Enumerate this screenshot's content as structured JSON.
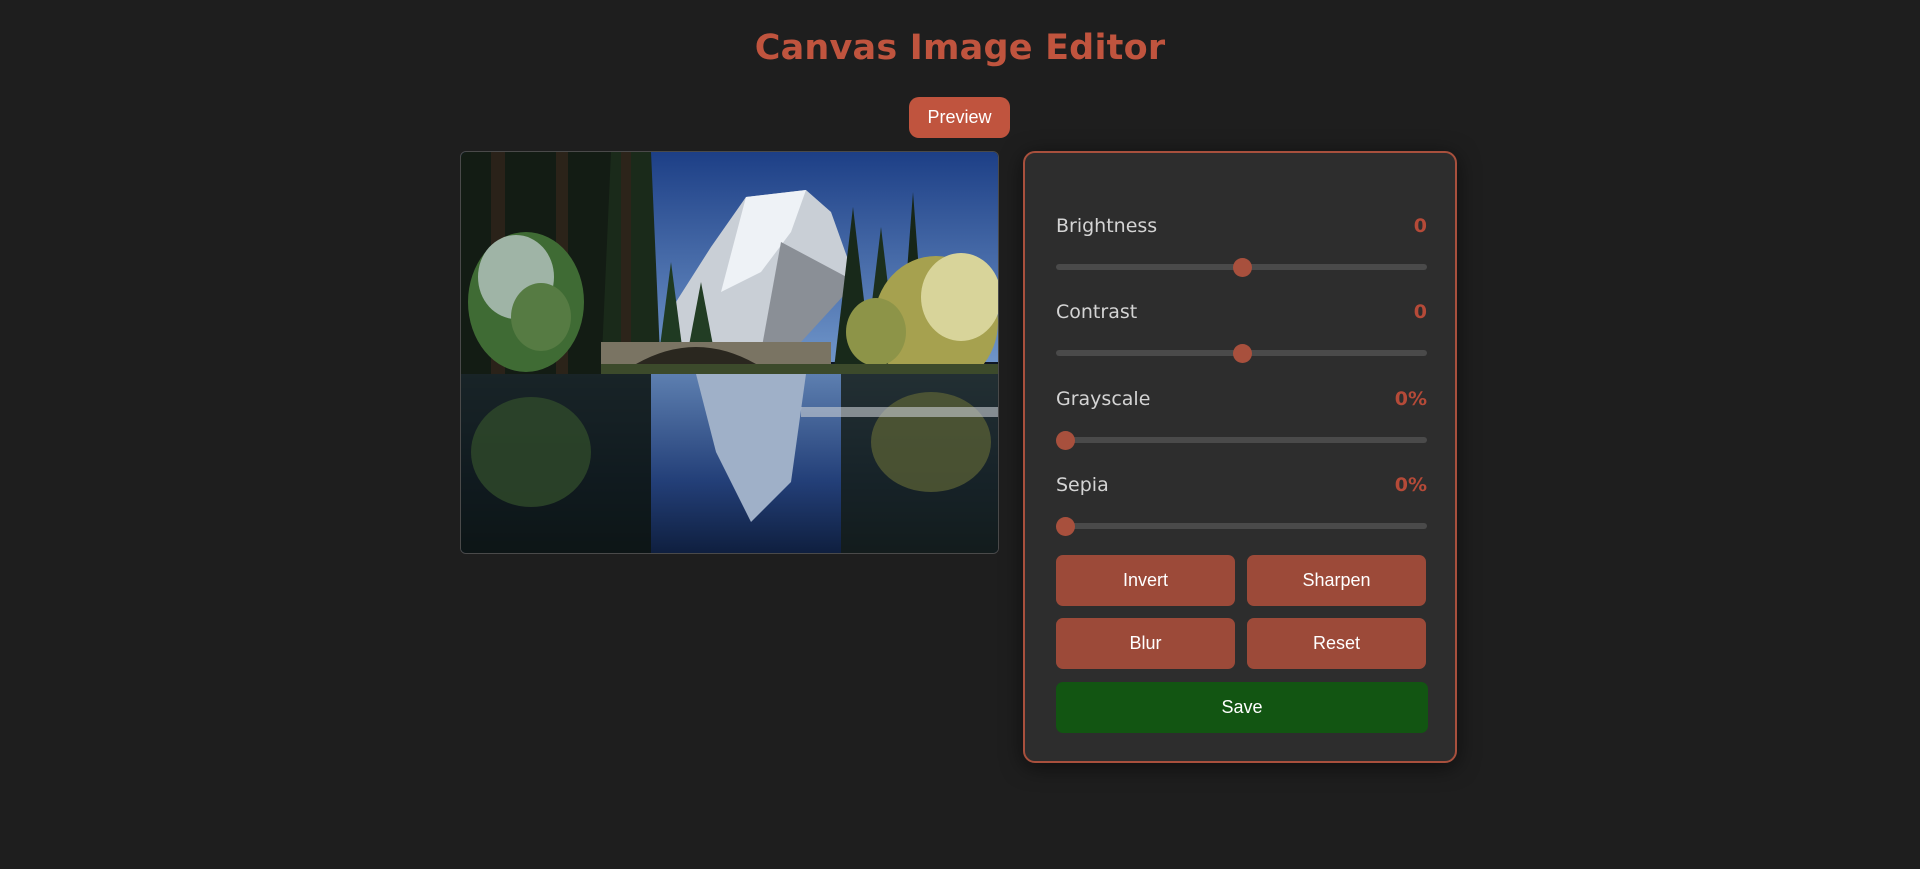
{
  "app": {
    "title": "Canvas Image Editor",
    "preview_label": "Preview",
    "accent_color": "#c0543e",
    "save_color": "#125512"
  },
  "canvas": {
    "image_description_icon": "landscape-image"
  },
  "controls": {
    "brightness": {
      "label": "Brightness",
      "value": "0",
      "level": 0.5
    },
    "contrast": {
      "label": "Contrast",
      "value": "0",
      "level": 0.5
    },
    "grayscale": {
      "label": "Grayscale",
      "value": "0%",
      "level": 0.0
    },
    "sepia": {
      "label": "Sepia",
      "value": "0%",
      "level": 0.0
    }
  },
  "buttons": {
    "invert": "Invert",
    "sharpen": "Sharpen",
    "blur": "Blur",
    "reset": "Reset",
    "save": "Save"
  }
}
